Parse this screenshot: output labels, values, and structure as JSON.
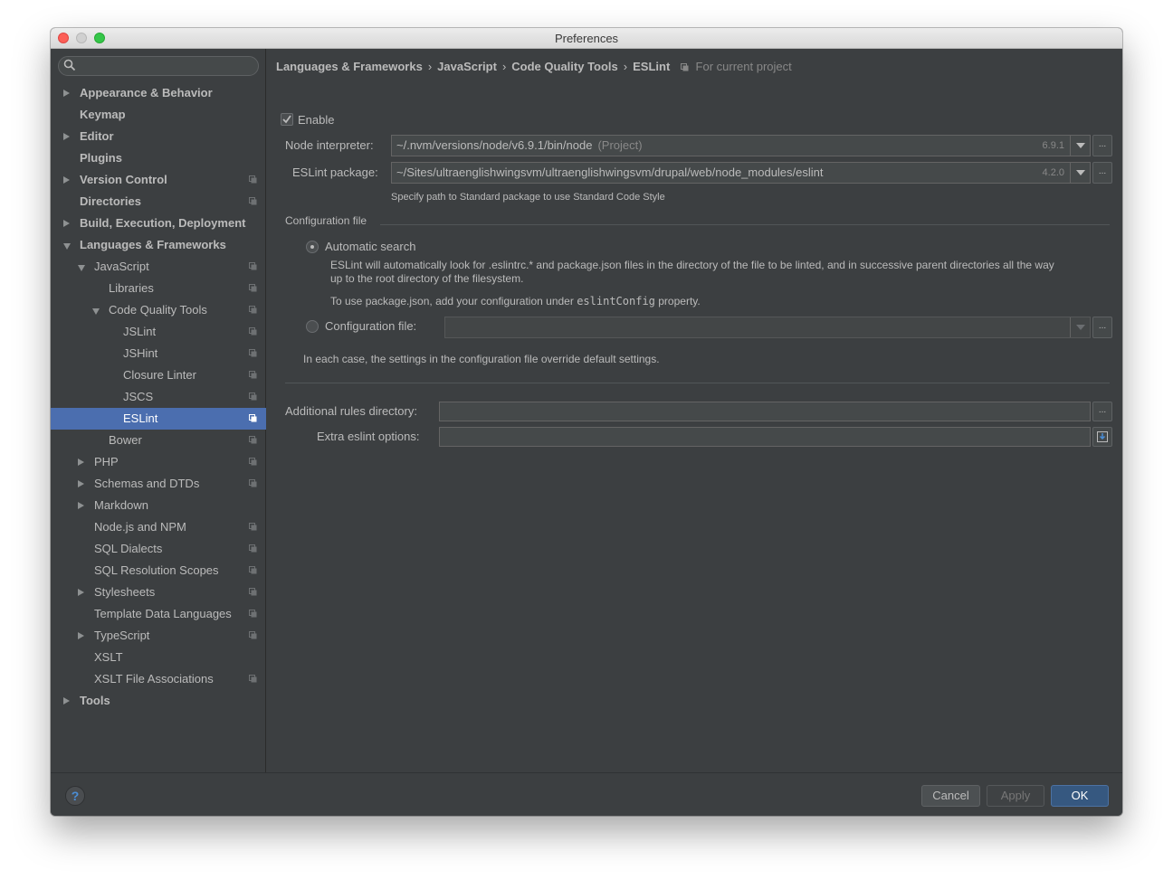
{
  "window": {
    "title": "Preferences"
  },
  "sidebar": {
    "search_placeholder": "",
    "items": [
      {
        "label": "Appearance & Behavior",
        "bold": true,
        "level": 0,
        "arrow": "right",
        "proj": false
      },
      {
        "label": "Keymap",
        "bold": true,
        "level": 0,
        "arrow": "none",
        "proj": false
      },
      {
        "label": "Editor",
        "bold": true,
        "level": 0,
        "arrow": "right",
        "proj": false
      },
      {
        "label": "Plugins",
        "bold": true,
        "level": 0,
        "arrow": "none",
        "proj": false
      },
      {
        "label": "Version Control",
        "bold": true,
        "level": 0,
        "arrow": "right",
        "proj": true
      },
      {
        "label": "Directories",
        "bold": true,
        "level": 0,
        "arrow": "none",
        "proj": true
      },
      {
        "label": "Build, Execution, Deployment",
        "bold": true,
        "level": 0,
        "arrow": "right",
        "proj": false
      },
      {
        "label": "Languages & Frameworks",
        "bold": true,
        "level": 0,
        "arrow": "down",
        "proj": false
      },
      {
        "label": "JavaScript",
        "bold": false,
        "level": 1,
        "arrow": "down",
        "proj": true
      },
      {
        "label": "Libraries",
        "bold": false,
        "level": 2,
        "arrow": "none",
        "proj": true
      },
      {
        "label": "Code Quality Tools",
        "bold": false,
        "level": 2,
        "arrow": "down",
        "proj": true
      },
      {
        "label": "JSLint",
        "bold": false,
        "level": 3,
        "arrow": "none",
        "proj": true
      },
      {
        "label": "JSHint",
        "bold": false,
        "level": 3,
        "arrow": "none",
        "proj": true
      },
      {
        "label": "Closure Linter",
        "bold": false,
        "level": 3,
        "arrow": "none",
        "proj": true
      },
      {
        "label": "JSCS",
        "bold": false,
        "level": 3,
        "arrow": "none",
        "proj": true
      },
      {
        "label": "ESLint",
        "bold": false,
        "level": 3,
        "arrow": "none",
        "proj": true,
        "selected": true
      },
      {
        "label": "Bower",
        "bold": false,
        "level": 2,
        "arrow": "none",
        "proj": true
      },
      {
        "label": "PHP",
        "bold": false,
        "level": 1,
        "arrow": "right",
        "proj": true
      },
      {
        "label": "Schemas and DTDs",
        "bold": false,
        "level": 1,
        "arrow": "right",
        "proj": true
      },
      {
        "label": "Markdown",
        "bold": false,
        "level": 1,
        "arrow": "right",
        "proj": false
      },
      {
        "label": "Node.js and NPM",
        "bold": false,
        "level": 1,
        "arrow": "none",
        "proj": true
      },
      {
        "label": "SQL Dialects",
        "bold": false,
        "level": 1,
        "arrow": "none",
        "proj": true
      },
      {
        "label": "SQL Resolution Scopes",
        "bold": false,
        "level": 1,
        "arrow": "none",
        "proj": true
      },
      {
        "label": "Stylesheets",
        "bold": false,
        "level": 1,
        "arrow": "right",
        "proj": true
      },
      {
        "label": "Template Data Languages",
        "bold": false,
        "level": 1,
        "arrow": "none",
        "proj": true
      },
      {
        "label": "TypeScript",
        "bold": false,
        "level": 1,
        "arrow": "right",
        "proj": true
      },
      {
        "label": "XSLT",
        "bold": false,
        "level": 1,
        "arrow": "none",
        "proj": false
      },
      {
        "label": "XSLT File Associations",
        "bold": false,
        "level": 1,
        "arrow": "none",
        "proj": true
      },
      {
        "label": "Tools",
        "bold": true,
        "level": 0,
        "arrow": "right",
        "proj": false
      }
    ]
  },
  "breadcrumb": {
    "crumbs": [
      "Languages & Frameworks",
      "JavaScript",
      "Code Quality Tools",
      "ESLint"
    ],
    "separator": "›",
    "scope": "For current project"
  },
  "eslint": {
    "enable_label": "Enable",
    "enabled": true,
    "node_interpreter_label": "Node interpreter:",
    "node_interpreter_value": "~/.nvm/versions/node/v6.9.1/bin/node",
    "node_interpreter_suffix": "(Project)",
    "node_version": "6.9.1",
    "package_label": "ESLint package:",
    "package_value": "~/Sites/ultraenglishwingsvm/ultraenglishwingsvm/drupal/web/node_modules/eslint",
    "package_version": "4.2.0",
    "package_hint": "Specify path to Standard package to use Standard Code Style",
    "config_section_title": "Configuration file",
    "auto_search_label": "Automatic search",
    "auto_search_desc_1": "ESLint will automatically look for .eslintrc.* and package.json files in the directory of the file to be linted, and in successive parent directories all the way",
    "auto_search_desc_2": "up to the root directory of the filesystem.",
    "package_json_note_pre": "To use package.json, add your configuration under",
    "package_json_note_code": "eslintConfig",
    "package_json_note_post": "property.",
    "config_file_label": "Configuration file:",
    "config_file_value": "",
    "override_note": "In each case, the settings in the configuration file override default settings.",
    "additional_rules_label": "Additional rules directory:",
    "additional_rules_value": "",
    "extra_options_label": "Extra eslint options:",
    "extra_options_value": "",
    "ellipsis": "..."
  },
  "footer": {
    "help": "?",
    "cancel": "Cancel",
    "apply": "Apply",
    "ok": "OK"
  },
  "colors": {
    "background": "#3c3f41",
    "selection": "#4b6eaf",
    "primary_button": "#365880",
    "text": "#bbbbbb"
  }
}
